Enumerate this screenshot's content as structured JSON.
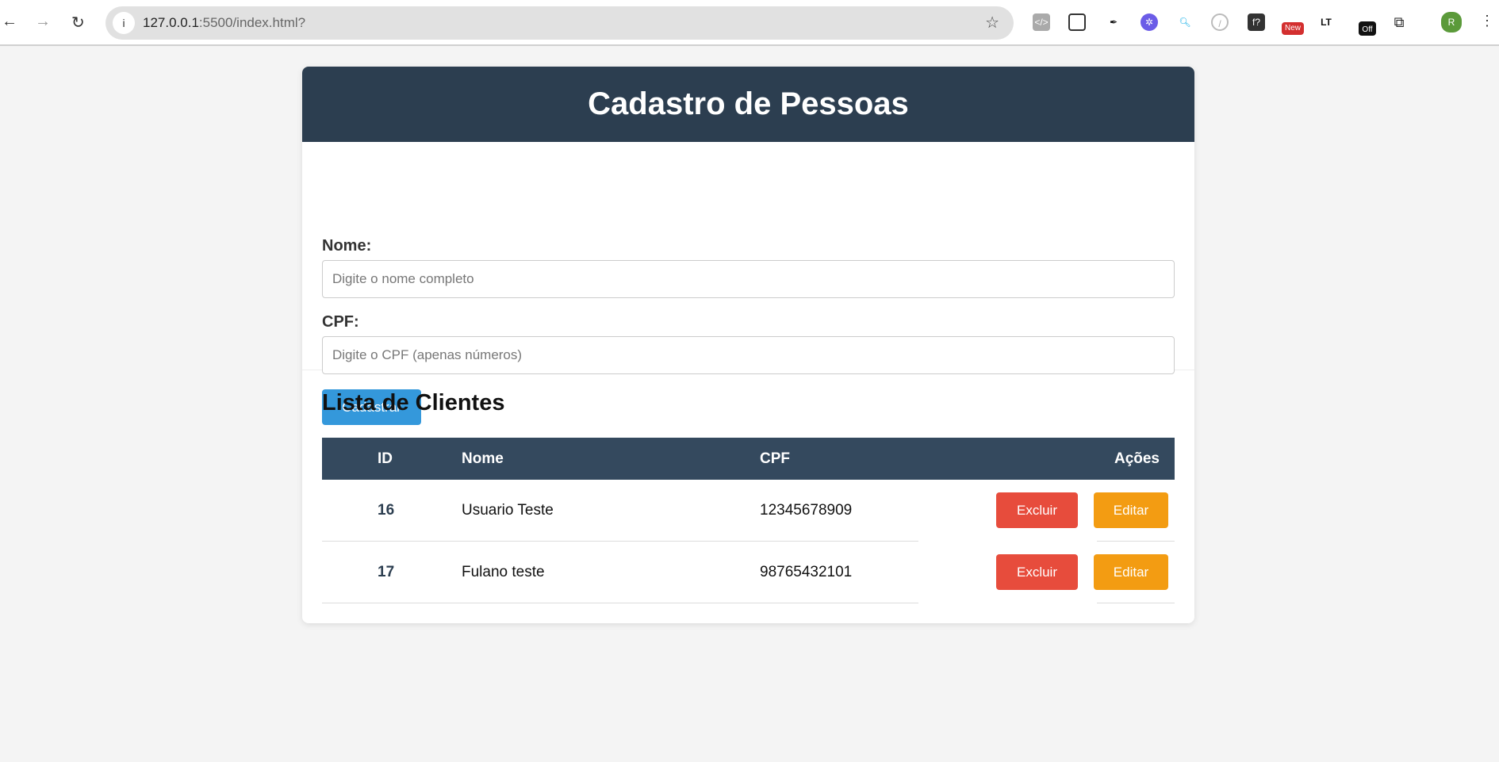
{
  "browser": {
    "url_host": "127.0.0.1",
    "url_rest": ":5500/index.html?",
    "extensions": [
      "code-icon",
      "screenshot-icon",
      "eyedropper-icon",
      "snowflake-icon",
      "search-zoom-icon",
      "compass-icon",
      "font-icon",
      "new-badge-icon",
      "lt-icon",
      "off-badge-icon",
      "puzzle-icon"
    ],
    "avatar": "R"
  },
  "header": {
    "title": "Cadastro de Pessoas"
  },
  "form": {
    "nome_label": "Nome:",
    "nome_placeholder": "Digite o nome completo",
    "nome_value": "",
    "cpf_label": "CPF:",
    "cpf_placeholder": "Digite o CPF (apenas números)",
    "cpf_value": "",
    "submit": "Cadastrar"
  },
  "list": {
    "title": "Lista de Clientes",
    "columns": [
      "ID",
      "Nome",
      "CPF",
      "Ações"
    ],
    "rows": [
      {
        "id": "16",
        "nome": "Usuario Teste",
        "cpf": "12345678909",
        "delete": "Excluir",
        "edit": "Editar"
      },
      {
        "id": "17",
        "nome": "Fulano teste",
        "cpf": "98765432101",
        "delete": "Excluir",
        "edit": "Editar"
      }
    ]
  },
  "colors": {
    "header": "#2c3e50",
    "table_header": "#34495e",
    "primary": "#3498db",
    "danger": "#e74c3c",
    "warning": "#f39c12"
  }
}
